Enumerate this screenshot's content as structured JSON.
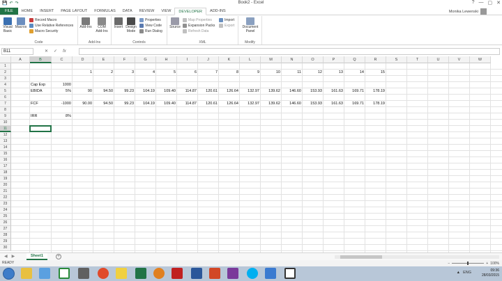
{
  "window": {
    "title": "Book2 - Excel",
    "user": "Monika Lewenski",
    "controls": [
      "?",
      "—",
      "▢",
      "✕"
    ]
  },
  "qat": [
    "💾",
    "↶",
    "↷"
  ],
  "tabs": [
    "FILE",
    "HOME",
    "INSERT",
    "PAGE LAYOUT",
    "FORMULAS",
    "DATA",
    "REVIEW",
    "VIEW",
    "DEVELOPER",
    "ADD-INS"
  ],
  "active_tab": "DEVELOPER",
  "ribbon": {
    "code": {
      "name": "Code",
      "visual_basic": "Visual Basic",
      "macros": "Macros",
      "record_macro": "Record Macro",
      "relative_refs": "Use Relative References",
      "macro_security": "Macro Security"
    },
    "addins": {
      "name": "Add-Ins",
      "addins": "Add-Ins",
      "com_addins": "COM Add-Ins"
    },
    "controls": {
      "name": "Controls",
      "insert": "Insert",
      "design_mode": "Design Mode",
      "properties": "Properties",
      "view_code": "View Code",
      "run_dialog": "Run Dialog"
    },
    "xml": {
      "name": "XML",
      "source": "Source",
      "map_properties": "Map Properties",
      "expansion_packs": "Expansion Packs",
      "refresh_data": "Refresh Data",
      "import": "Import",
      "export": "Export"
    },
    "modify": {
      "name": "Modify",
      "document_panel": "Document Panel"
    }
  },
  "formula_bar": {
    "name_box": "B11",
    "fx": "fx",
    "value": ""
  },
  "columns": [
    "A",
    "B",
    "C",
    "D",
    "E",
    "F",
    "G",
    "H",
    "I",
    "J",
    "K",
    "L",
    "M",
    "N",
    "O",
    "P",
    "Q",
    "R",
    "S",
    "T",
    "U",
    "V",
    "W"
  ],
  "rows": [
    "1",
    "2",
    "3",
    "4",
    "5",
    "6",
    "7",
    "8",
    "9",
    "10",
    "11",
    "12",
    "13",
    "14",
    "15",
    "16",
    "17",
    "18",
    "19",
    "20",
    "21",
    "22",
    "23",
    "24",
    "25",
    "26",
    "27",
    "28",
    "29",
    "30"
  ],
  "cells": {
    "row2": [
      "1",
      "2",
      "3",
      "4",
      "5",
      "6",
      "7",
      "8",
      "9",
      "10",
      "11",
      "12",
      "13",
      "14",
      "15"
    ],
    "b4": "Cap Exp",
    "c4": "1000",
    "b5": "EBIDA",
    "c5": "5%",
    "row5": [
      "90",
      "94.50",
      "99.23",
      "104.19",
      "109.40",
      "114.87",
      "120.61",
      "126.64",
      "132.97",
      "139.62",
      "146.60",
      "153.93",
      "161.63",
      "169.71",
      "178.19"
    ],
    "b7": "FCF",
    "c7": "-1000",
    "row7": [
      "90.00",
      "94.50",
      "99.23",
      "104.19",
      "109.40",
      "114.87",
      "120.61",
      "126.64",
      "132.97",
      "139.62",
      "146.60",
      "153.93",
      "161.63",
      "169.71",
      "178.19"
    ],
    "b9": "IRR",
    "c9": "8%"
  },
  "sheets": [
    "Sheet1"
  ],
  "status": {
    "ready": "READY",
    "zoom": "100%"
  },
  "tray": {
    "lang": "ENG",
    "time": "09:36",
    "date": "28/03/2015"
  }
}
